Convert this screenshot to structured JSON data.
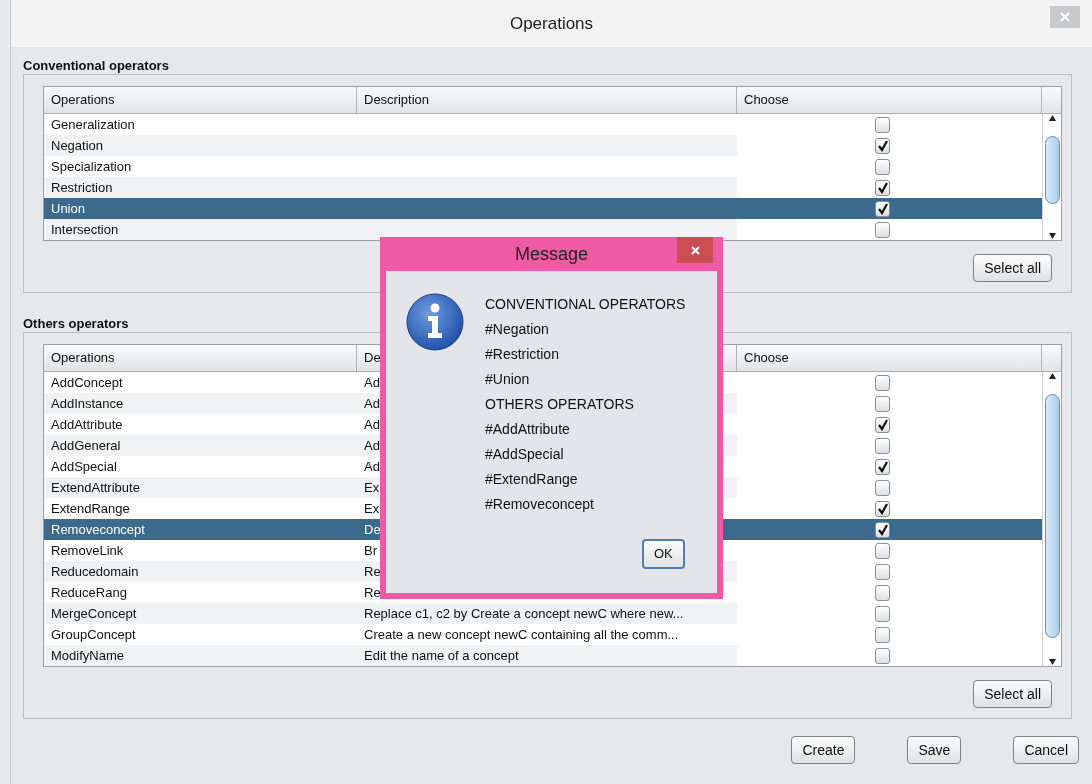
{
  "window": {
    "title": "Operations"
  },
  "conventional": {
    "title": "Conventional operators",
    "columns": [
      "Operations",
      "Description",
      "Choose"
    ],
    "rows": [
      {
        "operation": "Generalization",
        "checked": false,
        "selected": false
      },
      {
        "operation": "Negation",
        "checked": true,
        "selected": false
      },
      {
        "operation": "Specialization",
        "checked": false,
        "selected": false
      },
      {
        "operation": "Restriction",
        "checked": true,
        "selected": false
      },
      {
        "operation": "Union",
        "checked": true,
        "selected": true
      },
      {
        "operation": "Intersection",
        "checked": false,
        "selected": false
      }
    ],
    "button": "Select all"
  },
  "others": {
    "title": "Others operators",
    "columns": [
      "Operations",
      "De",
      "Choose"
    ],
    "rows": [
      {
        "operation": "AddConcept",
        "description": "Ad",
        "checked": false,
        "selected": false
      },
      {
        "operation": "AddInstance",
        "description": "Ad",
        "checked": false,
        "selected": false
      },
      {
        "operation": "AddAttribute",
        "description": "Ad",
        "checked": true,
        "selected": false
      },
      {
        "operation": "AddGeneral",
        "description": "Ad",
        "checked": false,
        "selected": false
      },
      {
        "operation": "AddSpecial",
        "description": "Ad",
        "checked": true,
        "selected": false
      },
      {
        "operation": "ExtendAttribute",
        "description": "Ex",
        "checked": false,
        "selected": false
      },
      {
        "operation": "ExtendRange",
        "description": "Ex",
        "checked": true,
        "selected": false
      },
      {
        "operation": "Removeconcept",
        "description": "De",
        "checked": true,
        "selected": true
      },
      {
        "operation": "RemoveLink",
        "description": "Br",
        "checked": false,
        "selected": false
      },
      {
        "operation": "Reducedomain",
        "description": "Re",
        "checked": false,
        "selected": false
      },
      {
        "operation": "ReduceRang",
        "description": "Re",
        "checked": false,
        "selected": false
      },
      {
        "operation": "MergeConcept",
        "description": "Replace c1, c2 by Create a concept newC where new...",
        "checked": false,
        "selected": false
      },
      {
        "operation": "GroupConcept",
        "description": "Create  a new concept newC containing all the comm...",
        "checked": false,
        "selected": false
      },
      {
        "operation": "ModifyName",
        "description": "Edit the name of a concept",
        "checked": false,
        "selected": false
      }
    ],
    "button": "Select all"
  },
  "buttons": [
    "Create",
    "Save",
    "Cancel"
  ],
  "message": {
    "title": "Message",
    "lines": [
      "CONVENTIONAL OPERATORS",
      "#Negation",
      "#Restriction",
      "#Union",
      "OTHERS OPERATORS",
      "#AddAttribute",
      "#AddSpecial",
      "#ExtendRange",
      "#Removeconcept"
    ],
    "button": "OK"
  }
}
